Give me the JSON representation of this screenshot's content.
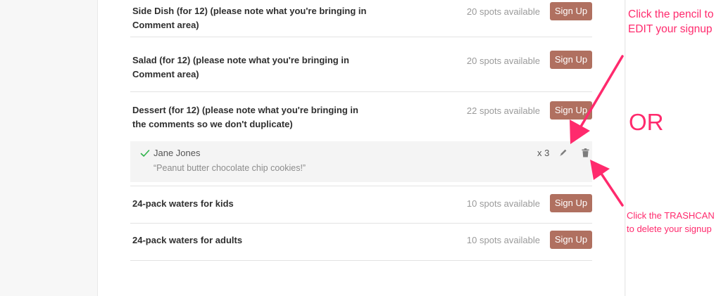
{
  "items": [
    {
      "title": "Side Dish (for 12) (please note what you're bringing in Comment area)",
      "spots": "20 spots available",
      "button": "Sign Up"
    },
    {
      "title": "Salad (for 12) (please note what you're bringing in Comment area)",
      "spots": "20 spots available",
      "button": "Sign Up"
    },
    {
      "title": "Dessert (for 12) (please note what you're bringing in the comments so we don't duplicate)",
      "spots": "22 spots available",
      "button": "Sign Up"
    },
    {
      "title": "24-pack waters for kids",
      "spots": "10 spots available",
      "button": "Sign Up"
    },
    {
      "title": "24-pack waters for adults",
      "spots": "10 spots available",
      "button": "Sign Up"
    }
  ],
  "signup": {
    "name": "Jane Jones",
    "comment": "“Peanut butter chocolate chip cookies!”",
    "quantity": "x 3"
  },
  "annotations": {
    "edit": "Click the pencil to EDIT your signup",
    "or": "OR",
    "trash": "Click the TRASHCAN to delete your signup"
  },
  "colors": {
    "button": "#b07060",
    "annotation": "#ff2a6d",
    "check": "#2fb34a"
  },
  "icons": [
    "check-icon",
    "pencil-icon",
    "trash-icon"
  ]
}
